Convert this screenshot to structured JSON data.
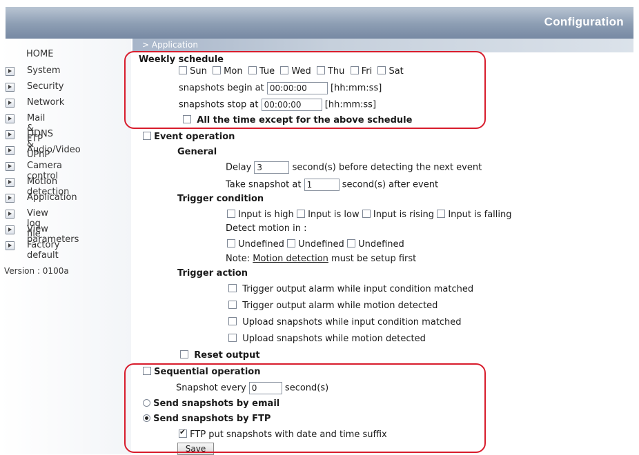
{
  "header": {
    "title": "Configuration"
  },
  "breadcrumb": "> Application",
  "sidebar": {
    "home": "HOME",
    "items": [
      {
        "label": "System"
      },
      {
        "label": "Security"
      },
      {
        "label": "Network"
      },
      {
        "label": "Mail & FTP"
      },
      {
        "label": "DDNS & UPnP"
      },
      {
        "label": "Audio/Video"
      },
      {
        "label": "Camera control"
      },
      {
        "label": "Motion detection"
      },
      {
        "label": "Application"
      },
      {
        "label": "View log file"
      },
      {
        "label": "View parameters"
      },
      {
        "label": "Factory default"
      }
    ],
    "version": "Version : 0100a"
  },
  "weekly": {
    "title": "Weekly schedule",
    "days": [
      "Sun",
      "Mon",
      "Tue",
      "Wed",
      "Thu",
      "Fri",
      "Sat"
    ],
    "begin_label": "snapshots begin at",
    "begin_value": "00:00:00",
    "stop_label": "snapshots stop at",
    "stop_value": "00:00:00",
    "time_hint": "[hh:mm:ss]",
    "all_time_label": "All the time except for the above schedule"
  },
  "event": {
    "title": "Event operation",
    "general": "General",
    "delay_label": "Delay",
    "delay_value": "3",
    "delay_suffix": "second(s) before detecting the next event",
    "take_label": "Take snapshot at",
    "take_value": "1",
    "take_suffix": "second(s) after event",
    "trigger_condition": "Trigger condition",
    "inputs": [
      "Input is high",
      "Input is low",
      "Input is rising",
      "Input is falling"
    ],
    "detect_label": "Detect motion in :",
    "motion_regions": [
      "Undefined",
      "Undefined",
      "Undefined"
    ],
    "note_prefix": "Note:",
    "note_link": "Motion detection",
    "note_suffix": "must be setup first",
    "trigger_action": "Trigger action",
    "actions": [
      "Trigger output alarm while input condition matched",
      "Trigger output alarm while motion detected",
      "Upload snapshots while input condition matched",
      "Upload snapshots while motion detected"
    ],
    "reset_output": "Reset output"
  },
  "sequential": {
    "title": "Sequential operation",
    "every_label": "Snapshot every",
    "every_value": "0",
    "every_suffix": "second(s)",
    "email_label": "Send snapshots by email",
    "ftp_label": "Send snapshots by FTP",
    "ftp_suffix_label": "FTP put snapshots with date and time suffix",
    "ftp_selected": true,
    "ftp_suffix_checked": true
  },
  "save_label": "Save",
  "colors": {
    "highlight": "#d81c2c",
    "header": "#8c9db3"
  }
}
